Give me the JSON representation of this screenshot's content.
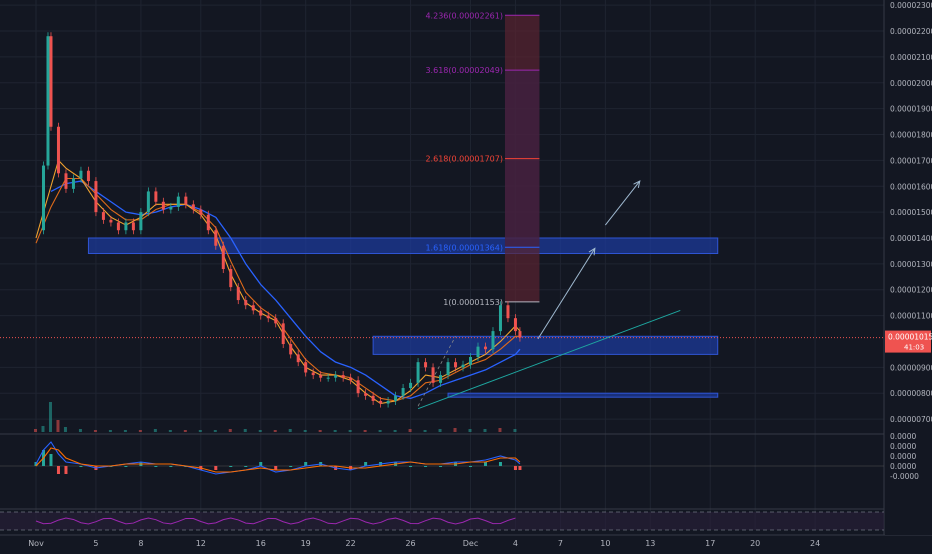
{
  "chart_data": {
    "type": "line",
    "theme": {
      "background": "#131722",
      "grid": "#1f2431",
      "axis_text": "#b2b5be",
      "up": "#26a69a",
      "down": "#ef5350",
      "ma_fast": "#f0a22e",
      "ma_slow": "#e06b1a",
      "ma_long": "#2962ff",
      "zone": "#1c3a99",
      "arrow": "#9fb9d0",
      "trendline": "#1ea7a0",
      "price_line": "#ef5350",
      "fib_box": "#5a2330"
    },
    "price_axis": {
      "ylim": [
        6.5e-06,
        2.32e-05
      ],
      "ticks": [
        "0.00002300",
        "0.00002200",
        "0.00002100",
        "0.00002000",
        "0.00001900",
        "0.00001800",
        "0.00001700",
        "0.00001600",
        "0.00001500",
        "0.00001400",
        "0.00001300",
        "0.00001200",
        "0.00001100",
        "0.00000900",
        "0.00000800",
        "0.00000700"
      ],
      "tick_values": [
        2.3e-05,
        2.2e-05,
        2.1e-05,
        2e-05,
        1.9e-05,
        1.8e-05,
        1.7e-05,
        1.6e-05,
        1.5e-05,
        1.4e-05,
        1.3e-05,
        1.2e-05,
        1.1e-05,
        9e-06,
        8e-06,
        7e-06
      ]
    },
    "last_price": {
      "label": "0.00001015",
      "value": 1.015e-05,
      "countdown": "41:03"
    },
    "x_axis": {
      "range": [
        0,
        59
      ],
      "labels": [
        "Nov",
        "5",
        "8",
        "12",
        "16",
        "19",
        "22",
        "26",
        "Dec",
        "4",
        "7",
        "10",
        "13",
        "17",
        "20",
        "24"
      ],
      "positions": [
        0,
        4,
        7,
        11,
        15,
        18,
        21,
        25,
        29,
        32,
        35,
        38,
        41,
        45,
        48,
        52
      ]
    },
    "price_series": {
      "name": "",
      "x": [
        0,
        0.5,
        0.8,
        1,
        1.5,
        2,
        2.5,
        3,
        3.5,
        4,
        4.5,
        5,
        5.5,
        6,
        6.5,
        7,
        7.5,
        8,
        8.5,
        9,
        9.5,
        10,
        10.5,
        11,
        11.5,
        12,
        12.5,
        13,
        13.5,
        14,
        14.5,
        15,
        15.5,
        16,
        16.5,
        17,
        17.5,
        18,
        18.5,
        19,
        19.5,
        20,
        20.5,
        21,
        21.5,
        22,
        22.5,
        23,
        23.5,
        24,
        24.5,
        25,
        25.5,
        26,
        26.5,
        27,
        27.5,
        28,
        28.5,
        29,
        29.5,
        30,
        30.5,
        31,
        31.5,
        32,
        32.3
      ],
      "y": [
        1.43e-05,
        1.68e-05,
        2.18e-05,
        1.83e-05,
        1.65e-05,
        1.59e-05,
        1.63e-05,
        1.66e-05,
        1.62e-05,
        1.5e-05,
        1.47e-05,
        1.46e-05,
        1.43e-05,
        1.46e-05,
        1.43e-05,
        1.5e-05,
        1.58e-05,
        1.54e-05,
        1.51e-05,
        1.52e-05,
        1.56e-05,
        1.53e-05,
        1.51e-05,
        1.49e-05,
        1.43e-05,
        1.37e-05,
        1.28e-05,
        1.21e-05,
        1.16e-05,
        1.14e-05,
        1.12e-05,
        1.1e-05,
        1.09e-05,
        1.07e-05,
        9.9e-06,
        9.5e-06,
        9.2e-06,
        8.8e-06,
        8.7e-06,
        8.6e-06,
        8.6e-06,
        8.7e-06,
        8.6e-06,
        8.5e-06,
        8e-06,
        7.9e-06,
        7.7e-06,
        7.6e-06,
        7.7e-06,
        7.9e-06,
        8.2e-06,
        8.4e-06,
        9.2e-06,
        9e-06,
        8.4e-06,
        8.7e-06,
        9.2e-06,
        9e-06,
        9.1e-06,
        9.4e-06,
        9.8e-06,
        9.7e-06,
        1.04e-05,
        1.14e-05,
        1.09e-05,
        1.04e-05,
        1.015e-05
      ]
    },
    "ma_fast": {
      "name": "",
      "x": [
        0,
        1,
        1.5,
        2,
        3,
        4,
        5,
        6,
        7,
        8,
        9,
        10,
        11,
        12,
        13,
        14,
        15,
        16,
        17,
        18,
        19,
        20,
        21,
        22,
        23,
        24,
        25,
        26,
        27,
        28,
        29,
        30,
        31,
        32,
        32.3
      ],
      "y": [
        1.4e-05,
        1.6e-05,
        1.7e-05,
        1.67e-05,
        1.63e-05,
        1.54e-05,
        1.48e-05,
        1.45e-05,
        1.48e-05,
        1.53e-05,
        1.53e-05,
        1.53e-05,
        1.49e-05,
        1.41e-05,
        1.26e-05,
        1.15e-05,
        1.11e-05,
        1.08e-05,
        9.8e-06,
        9e-06,
        8.7e-06,
        8.7e-06,
        8.5e-06,
        8e-06,
        7.6e-06,
        7.7e-06,
        8.1e-06,
        8.7e-06,
        8.6e-06,
        8.9e-06,
        9.2e-06,
        9.5e-06,
        1e-05,
        1.06e-05,
        1.04e-05
      ]
    },
    "ma_slow": {
      "name": "",
      "x": [
        0,
        1,
        2,
        3,
        4,
        5,
        6,
        7,
        8,
        9,
        10,
        11,
        12,
        13,
        14,
        15,
        16,
        17,
        18,
        19,
        20,
        21,
        22,
        23,
        24,
        25,
        26,
        27,
        28,
        29,
        30,
        31,
        32,
        32.3
      ],
      "y": [
        1.38e-05,
        1.52e-05,
        1.63e-05,
        1.63e-05,
        1.57e-05,
        1.51e-05,
        1.47e-05,
        1.47e-05,
        1.51e-05,
        1.53e-05,
        1.53e-05,
        1.5e-05,
        1.44e-05,
        1.31e-05,
        1.19e-05,
        1.13e-05,
        1.09e-05,
        1.01e-05,
        9.3e-06,
        8.8e-06,
        8.7e-06,
        8.6e-06,
        8.2e-06,
        7.8e-06,
        7.7e-06,
        7.9e-06,
        8.4e-06,
        8.5e-06,
        8.8e-06,
        9.1e-06,
        9.3e-06,
        9.7e-06,
        1.02e-05,
        1.02e-05
      ]
    },
    "ma_long": {
      "name": "",
      "x": [
        1,
        2,
        3,
        4,
        5,
        6,
        7,
        8,
        9,
        10,
        11,
        12,
        13,
        14,
        15,
        16,
        17,
        18,
        19,
        20,
        21,
        22,
        23,
        24,
        25,
        26,
        27,
        28,
        29,
        30,
        31,
        32,
        32.3
      ],
      "y": [
        1.58e-05,
        1.61e-05,
        1.62e-05,
        1.58e-05,
        1.54e-05,
        1.5e-05,
        1.49e-05,
        1.5e-05,
        1.52e-05,
        1.53e-05,
        1.51e-05,
        1.48e-05,
        1.4e-05,
        1.3e-05,
        1.22e-05,
        1.16e-05,
        1.09e-05,
        1.02e-05,
        9.6e-06,
        9.2e-06,
        9e-06,
        8.7e-06,
        8.3e-06,
        7.9e-06,
        7.8e-06,
        8e-06,
        8.3e-06,
        8.5e-06,
        8.7e-06,
        8.9e-06,
        9.2e-06,
        9.5e-06,
        9.7e-06
      ]
    },
    "fibonacci": {
      "color": "#7b2cbf",
      "levels": [
        {
          "label": "4.236(0.00002261)",
          "value": 2.261e-05,
          "color": "#9c27b0"
        },
        {
          "label": "3.618(0.00002049)",
          "value": 2.049e-05,
          "color": "#9c27b0"
        },
        {
          "label": "2.618(0.00001707)",
          "value": 1.707e-05,
          "color": "#f44336"
        },
        {
          "label": "1.618(0.00001364)",
          "value": 1.364e-05,
          "color": "#2962ff"
        },
        {
          "label": "1(0.00001153)",
          "value": 1.153e-05,
          "color": "#b2b5be"
        }
      ]
    },
    "zones": [
      {
        "x": [
          3.5,
          45.5
        ],
        "y": [
          1.34e-05,
          1.4e-05
        ]
      },
      {
        "x": [
          22.5,
          45.5
        ],
        "y": [
          9.5e-06,
          1.02e-05
        ]
      },
      {
        "x": [
          27.5,
          45.5
        ],
        "y": [
          7.9e-06,
          8e-06
        ]
      }
    ],
    "trendline": {
      "x": [
        25.5,
        43
      ],
      "y": [
        7.4e-06,
        1.12e-05
      ]
    },
    "arrows": [
      {
        "x": [
          33.5,
          37.3
        ],
        "y": [
          1.01e-05,
          1.36e-05
        ]
      },
      {
        "x": [
          38,
          40.3
        ],
        "y": [
          1.45e-05,
          1.62e-05
        ]
      }
    ],
    "volume": {
      "x": [
        0,
        0.5,
        1,
        1.5,
        2,
        3,
        4,
        5,
        6,
        7,
        8,
        9,
        10,
        11,
        12,
        13,
        14,
        15,
        16,
        17,
        18,
        19,
        20,
        21,
        22,
        23,
        24,
        25,
        26,
        27,
        28,
        29,
        30,
        31,
        32
      ],
      "v": [
        3,
        6,
        30,
        12,
        5,
        3,
        2,
        2,
        2,
        2,
        3,
        2,
        2,
        2,
        2,
        3,
        3,
        2,
        2,
        3,
        2,
        2,
        2,
        2,
        2,
        2,
        2,
        3,
        2,
        3,
        4,
        3,
        3,
        4,
        3
      ]
    },
    "oscillator": {
      "ylim": [
        -0.0002,
        0.00015
      ],
      "ticks": [
        "0.0000",
        "0.0000",
        "0.0000",
        "0.0000",
        "-0.0000"
      ],
      "tick_values": [
        0.00015,
        0.0001,
        5e-05,
        0,
        -5e-05
      ],
      "x": [
        0,
        0.5,
        1,
        1.5,
        2,
        3,
        4,
        5,
        6,
        7,
        8,
        9,
        10,
        11,
        12,
        13,
        14,
        15,
        16,
        17,
        18,
        19,
        20,
        21,
        22,
        23,
        24,
        25,
        26,
        27,
        28,
        29,
        30,
        31,
        32,
        32.3
      ],
      "line": [
        1e-05,
        8e-05,
        0.00012,
        6e-05,
        2e-05,
        1e-05,
        -1e-05,
        0,
        1e-05,
        2e-05,
        1e-05,
        1e-05,
        0,
        -2e-05,
        -4e-05,
        -3e-05,
        -2e-05,
        0,
        -3e-05,
        -2e-05,
        0,
        1e-05,
        -1e-05,
        -2e-05,
        0,
        1e-05,
        2e-05,
        2e-05,
        1e-05,
        1e-05,
        2e-05,
        2e-05,
        3e-05,
        5e-05,
        3e-05,
        1e-05
      ],
      "signal": [
        0,
        4e-05,
        9e-05,
        8e-05,
        4e-05,
        1e-05,
        0,
        0,
        1e-05,
        1e-05,
        1e-05,
        1e-05,
        0,
        -1e-05,
        -3e-05,
        -3e-05,
        -2e-05,
        -1e-05,
        -2e-05,
        -2e-05,
        -1e-05,
        0,
        0,
        -1e-05,
        -1e-05,
        0,
        1e-05,
        2e-05,
        1e-05,
        1e-05,
        1e-05,
        2e-05,
        2e-05,
        4e-05,
        4e-05,
        2e-05
      ]
    }
  }
}
